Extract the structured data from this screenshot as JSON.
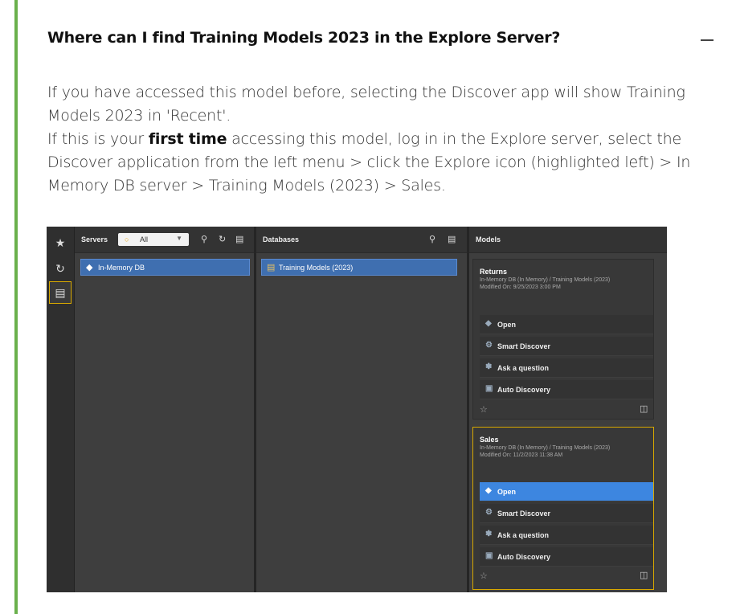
{
  "faq": {
    "question": "Where can I find Training Models 2023 in the Explore Server?",
    "answer_p1": "If you have accessed this model before, selecting the Discover app will show Training Models 2023 in 'Recent'.",
    "answer_p2_before": "If this is your ",
    "answer_p2_bold": "first time",
    "answer_p2_after": " accessing this model, log in in the Explore server, select the Discover application from the left menu > click the Explore icon (highlighted left) > In Memory DB server > Training Models (2023) > Sales."
  },
  "colors": {
    "accent": "#6ab04c",
    "selection": "#3f6fb0",
    "highlight": "#d8a800",
    "active_action": "#3d86e0"
  },
  "screenshot": {
    "rail": {
      "icons": [
        "star-icon",
        "history-icon",
        "database-icon"
      ]
    },
    "servers": {
      "title": "Servers",
      "filter_value": "All",
      "item": "In-Memory DB"
    },
    "databases": {
      "title": "Databases",
      "item": "Training Models (2023)"
    },
    "models": {
      "title": "Models",
      "cards": [
        {
          "name": "Returns",
          "path": "In-Memory DB (In Memory) / Training Models (2023)",
          "modified": "Modified On: 9/25/2023 3:00 PM",
          "actions": [
            "Open",
            "Smart Discover",
            "Ask a question",
            "Auto Discovery"
          ]
        },
        {
          "name": "Sales",
          "path": "In-Memory DB (In Memory) / Training Models (2023)",
          "modified": "Modified On: 11/2/2023 11:38 AM",
          "actions": [
            "Open",
            "Smart Discover",
            "Ask a question",
            "Auto Discovery"
          ]
        }
      ]
    }
  }
}
